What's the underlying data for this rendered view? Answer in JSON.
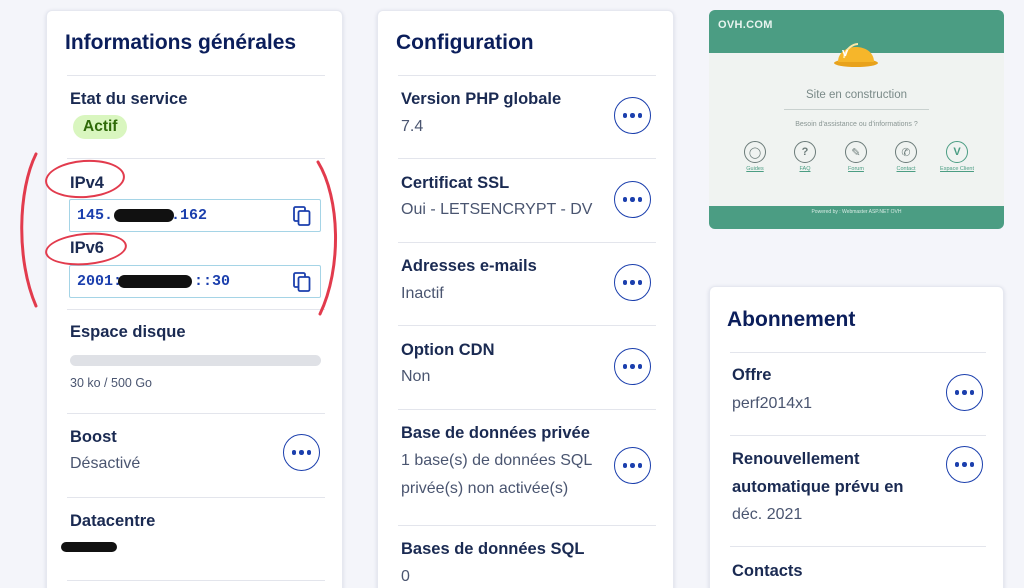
{
  "general": {
    "title": "Informations générales",
    "service_label": "Etat du service",
    "service_status": "Actif",
    "ipv4_label": "IPv4",
    "ipv4_prefix": "145.",
    "ipv4_suffix": ".162",
    "ipv6_label": "IPv6",
    "ipv6_prefix": "2001:",
    "ipv6_suffix": "::30",
    "disk_label": "Espace disque",
    "disk_usage_text": "30 ko / 500 Go",
    "disk_usage_fraction": 6e-05,
    "boost_label": "Boost",
    "boost_value": "Désactivé",
    "datacentre_label": "Datacentre"
  },
  "configuration": {
    "title": "Configuration",
    "rows": [
      {
        "label": "Version PHP globale",
        "value": "7.4"
      },
      {
        "label": "Certificat SSL",
        "value": "Oui - LETSENCRYPT - DV"
      },
      {
        "label": "Adresses e-mails",
        "value": "Inactif"
      },
      {
        "label": "Option CDN",
        "value": "Non"
      },
      {
        "label": "Base de données privée",
        "value": "1 base(s) de données SQL",
        "value2": "privée(s) non activée(s)"
      },
      {
        "label": "Bases de données SQL",
        "value": "0"
      }
    ]
  },
  "preview": {
    "brand": "OVH.COM",
    "title": "Site en construction",
    "subtitle": "Besoin d'assistance ou d'informations ?",
    "links": [
      "Guides",
      "FAQ",
      "Forum",
      "Contact",
      "Espace Client"
    ],
    "footer": "Powered by : Webmaster ASP.NET OVH"
  },
  "subscription": {
    "title": "Abonnement",
    "offer_label": "Offre",
    "offer_value": "perf2014x1",
    "renewal_label_1": "Renouvellement",
    "renewal_label_2": "automatique prévu en",
    "renewal_value": "déc. 2021",
    "contacts_label": "Contacts"
  },
  "colors": {
    "accent": "#1b3fad",
    "annotation": "#e23b4d",
    "status_ok_bg": "#d9f6bf",
    "preview_green": "#4b9d83"
  }
}
